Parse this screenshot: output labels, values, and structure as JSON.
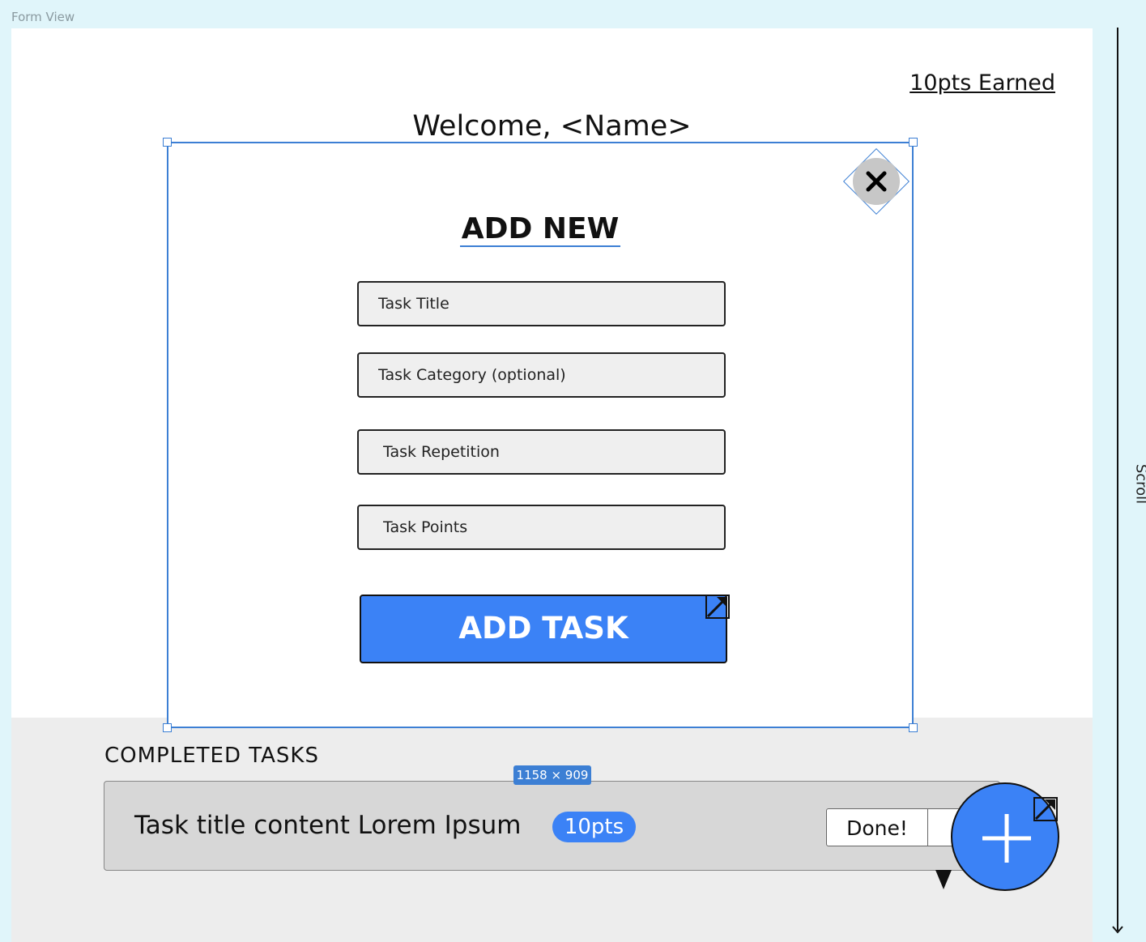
{
  "frame": {
    "label": "Form View"
  },
  "header": {
    "points_earned": "10pts Earned",
    "welcome": "Welcome, <Name>"
  },
  "modal": {
    "title": "ADD NEW",
    "fields": {
      "task_title": {
        "placeholder": "Task Title",
        "value": ""
      },
      "task_category": {
        "placeholder": "Task Category (optional)",
        "value": ""
      },
      "task_repetition": {
        "placeholder": "Task Repetition",
        "value": ""
      },
      "task_points": {
        "placeholder": "Task Points",
        "value": ""
      }
    },
    "submit_label": "ADD TASK",
    "close_icon": "close-icon",
    "selection_size": "1158 × 909"
  },
  "completed": {
    "heading": "COMPLETED TASKS",
    "tasks": [
      {
        "title": "Task title content Lorem Ipsum",
        "points": "10pts",
        "action": "Done!"
      }
    ]
  },
  "scroll": {
    "label": "Scroll"
  },
  "colors": {
    "accent": "#3b82f6",
    "selection": "#3c7fd4",
    "canvas": "#e0f5fa",
    "section_bg": "#ededed",
    "card_bg": "#d7d7d7"
  }
}
